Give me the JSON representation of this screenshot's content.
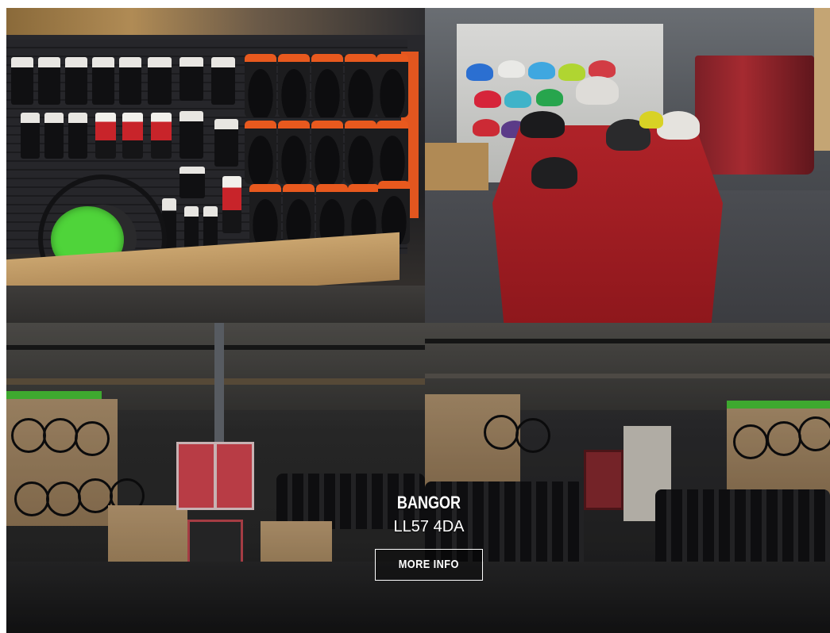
{
  "store": {
    "name": "BANGOR",
    "postcode": "LL57 4DA",
    "more_info_label": "MORE INFO"
  },
  "photos": [
    {
      "name": "accessories-wall-photo"
    },
    {
      "name": "helmet-display-photo"
    },
    {
      "name": "bike-showroom-left-photo"
    },
    {
      "name": "bike-showroom-right-photo"
    }
  ],
  "colors": {
    "accent_orange": "#e2561f",
    "accent_green": "#4ccf3a",
    "display_red": "#b3242a",
    "caption_text": "#ffffff"
  }
}
